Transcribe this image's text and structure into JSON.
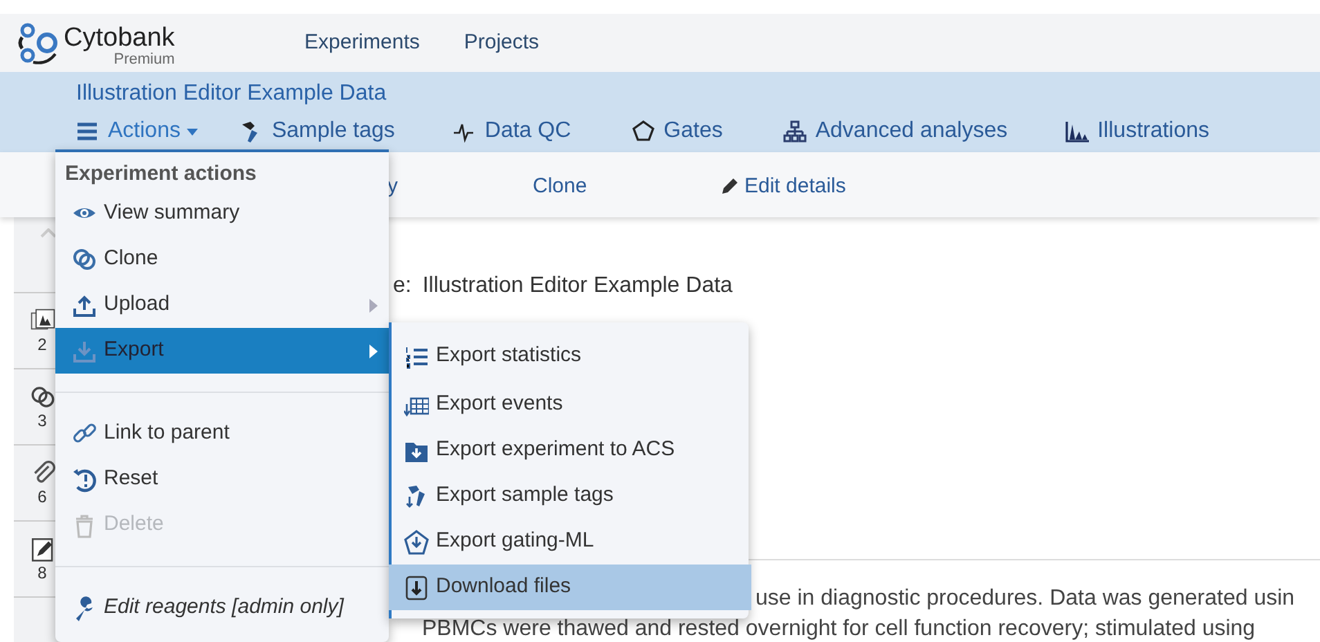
{
  "header": {
    "logo": "Cytobank",
    "edition": "Premium",
    "nav": [
      "Experiments",
      "Projects"
    ]
  },
  "experiment_bar": {
    "title": "Illustration Editor Example Data",
    "nav": [
      {
        "label": "Actions",
        "selected": true
      },
      {
        "label": "Sample tags",
        "selected": false
      },
      {
        "label": "Data QC",
        "selected": false
      },
      {
        "label": "Gates",
        "selected": false
      },
      {
        "label": "Advanced analyses",
        "selected": false
      },
      {
        "label": "Illustrations",
        "selected": false
      }
    ]
  },
  "toolbar": {
    "items": [
      "y",
      "Clone",
      "Edit details"
    ]
  },
  "sidebar": {
    "items": [
      {
        "count": "2"
      },
      {
        "count": "3"
      },
      {
        "count": "6"
      },
      {
        "count": "8"
      }
    ]
  },
  "content": {
    "name_label": "e:",
    "name_value": "Illustration Editor Example Data",
    "description_lines": [
      "use in diagnostic procedures. Data was generated usin",
      "PBMCs were thawed and rested overnight for cell function recovery; stimulated using"
    ]
  },
  "actions_menu": [
    {
      "kind": "heading",
      "label": "Experiment actions"
    },
    {
      "kind": "item",
      "label": "View summary",
      "selected": false,
      "disabled": false,
      "submenu": false
    },
    {
      "kind": "item",
      "label": "Clone",
      "selected": false,
      "disabled": false,
      "submenu": false
    },
    {
      "kind": "item",
      "label": "Upload",
      "selected": false,
      "disabled": false,
      "submenu": true
    },
    {
      "kind": "item",
      "label": "Export",
      "selected": true,
      "disabled": false,
      "submenu": true
    },
    {
      "kind": "separator"
    },
    {
      "kind": "item",
      "label": "Link to parent",
      "selected": false,
      "disabled": false,
      "submenu": false
    },
    {
      "kind": "item",
      "label": "Reset",
      "selected": false,
      "disabled": false,
      "submenu": false
    },
    {
      "kind": "item",
      "label": "Delete",
      "selected": false,
      "disabled": true,
      "submenu": false
    },
    {
      "kind": "separator"
    },
    {
      "kind": "admin",
      "label": "Edit reagents [admin only]",
      "selected": false,
      "disabled": false,
      "submenu": false
    }
  ],
  "export_submenu": [
    {
      "label": "Export statistics",
      "selected": false
    },
    {
      "label": "Export events",
      "selected": false
    },
    {
      "label": "Export experiment to ACS",
      "selected": false
    },
    {
      "label": "Export sample tags",
      "selected": false
    },
    {
      "label": "Export gating-ML",
      "selected": false
    },
    {
      "label": "Download files",
      "selected": true
    }
  ]
}
